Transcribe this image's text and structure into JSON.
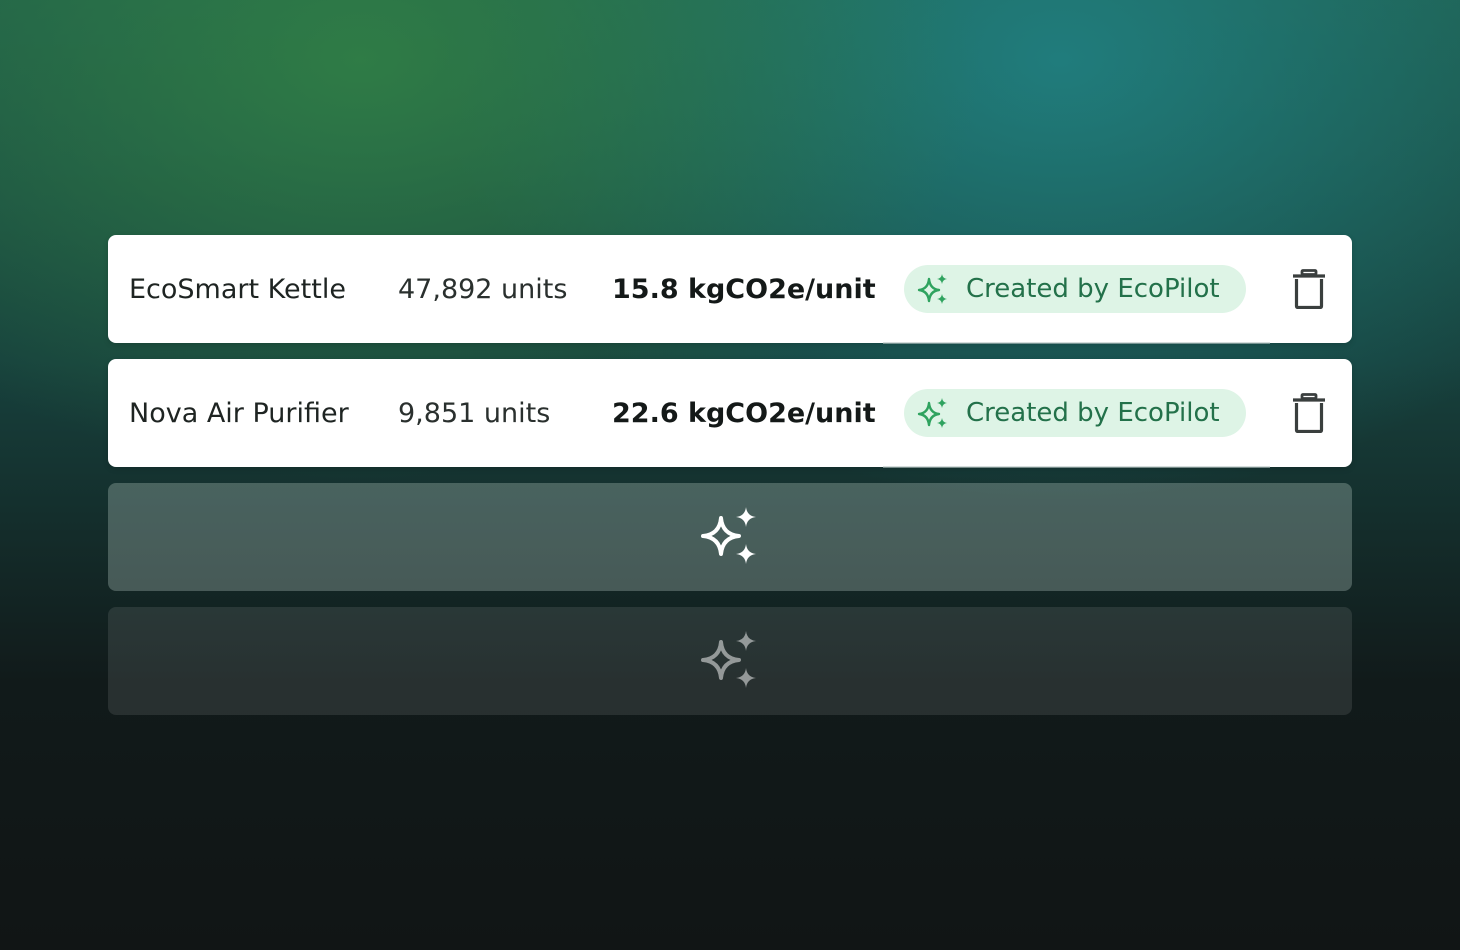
{
  "products": [
    {
      "name": "EcoSmart Kettle",
      "units": "47,892 units",
      "emissions": "15.8 kgCO2e/unit",
      "badge": "Created by EcoPilot"
    },
    {
      "name": "Nova Air Purifier",
      "units": "9,851 units",
      "emissions": "22.6 kgCO2e/unit",
      "badge": "Created by EcoPilot"
    }
  ],
  "icons": {
    "badge": "sparkles-icon",
    "delete": "trash-icon",
    "loading": "sparkles-icon"
  },
  "colors": {
    "badge_bg": "#def4e6",
    "badge_text": "#23714a",
    "badge_icon": "#2fa35f"
  }
}
